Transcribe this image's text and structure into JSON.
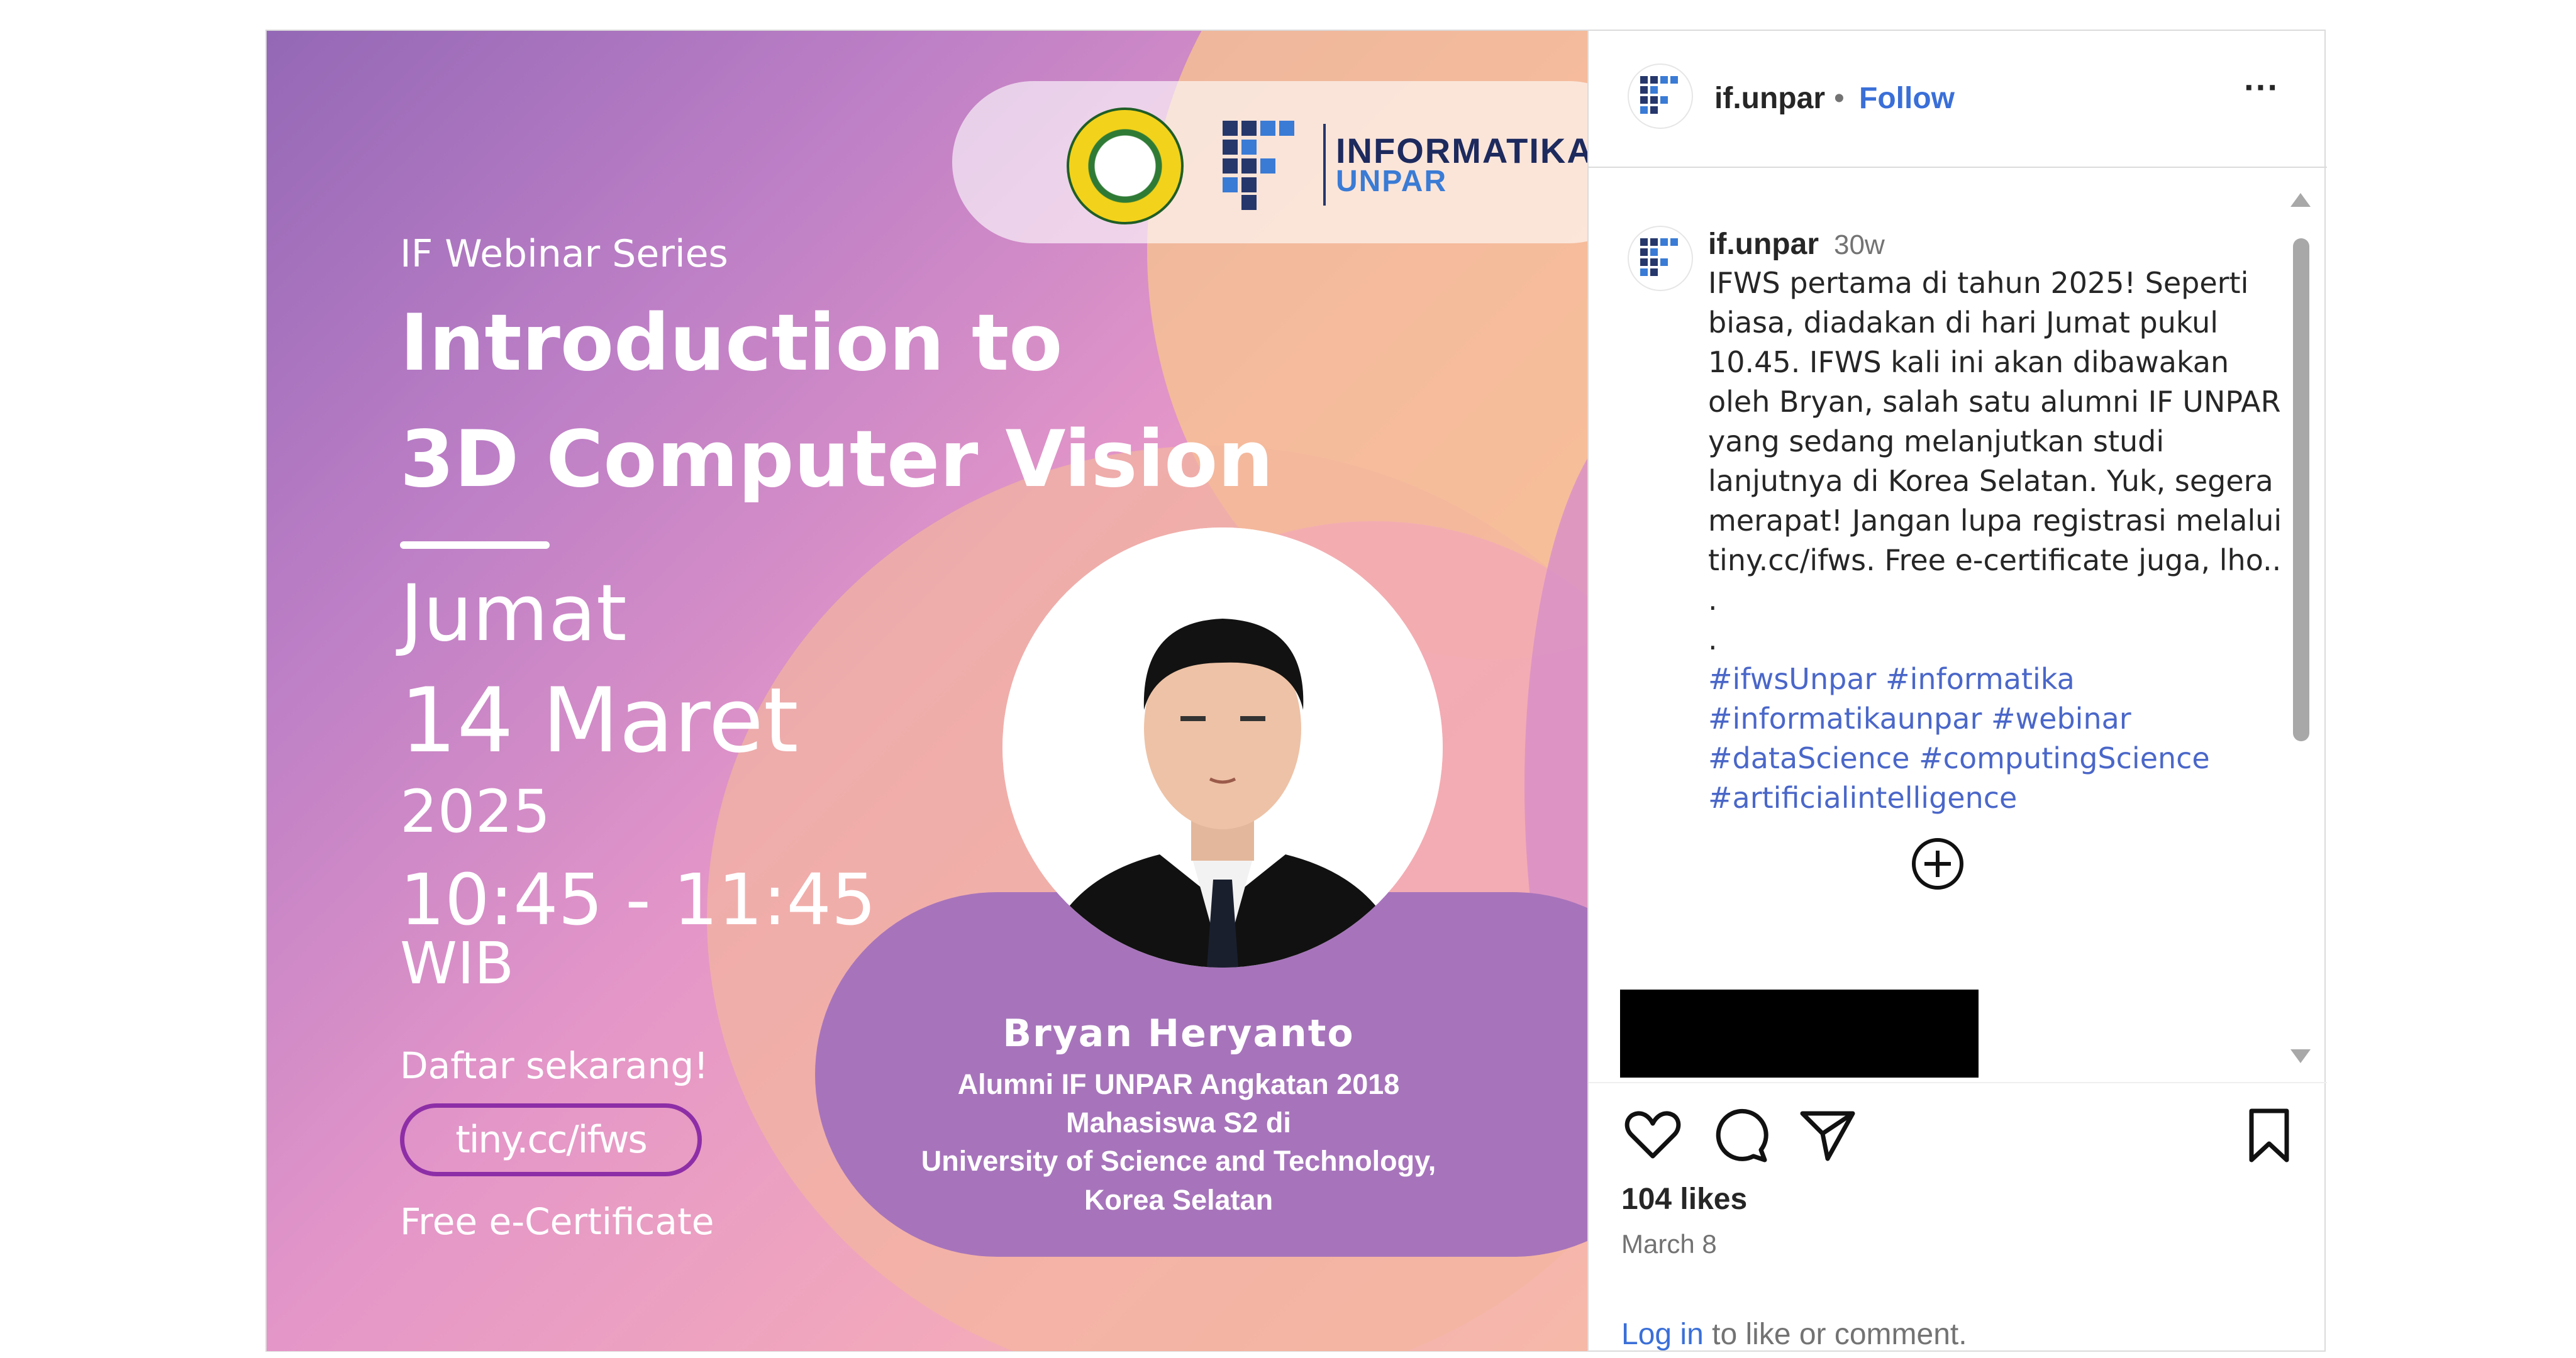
{
  "poster": {
    "series": "IF Webinar Series",
    "title_line1": "Introduction to",
    "title_line2": "3D Computer Vision",
    "day": "Jumat",
    "date": "14 Maret",
    "year": "2025",
    "time": "10:45 - 11:45",
    "timezone": "WIB",
    "register_prompt": "Daftar sekarang!",
    "register_link": "tiny.cc/ifws",
    "certificate": "Free e-Certificate",
    "brand_line1": "INFORMATIKA",
    "brand_line2": "UNPAR",
    "speaker": {
      "name": "Bryan Heryanto",
      "line1": "Alumni IF UNPAR Angkatan 2018",
      "line2": "Mahasiswa S2 di",
      "line3": "University of Science and Technology,",
      "line4": "Korea Selatan"
    }
  },
  "header": {
    "username": "if.unpar",
    "separator": "•",
    "follow_label": "Follow",
    "more_label": "···"
  },
  "comment": {
    "username": "if.unpar",
    "time": "30w",
    "caption_lines": [
      "IFWS pertama di tahun 2025! Seperti",
      "biasa, diadakan di hari Jumat pukul",
      "10.45. IFWS kali ini akan dibawakan",
      "oleh Bryan, salah satu alumni IF UNPAR",
      "yang sedang melanjutkan studi",
      "lanjutnya di Korea Selatan. Yuk, segera",
      "merapat! Jangan lupa registrasi melalui",
      "tiny.cc/ifws. Free e-certificate juga, lho..",
      ".",
      "."
    ],
    "hashtags": [
      [
        "#ifwsUnpar",
        "#informatika"
      ],
      [
        "#informatikaunpar",
        "#webinar"
      ],
      [
        "#dataScience",
        "#computingScience"
      ],
      [
        "#artificialintelligence"
      ]
    ]
  },
  "footer": {
    "likes": "104 likes",
    "date": "March 8",
    "login_link": "Log in",
    "login_rest": " to like or comment."
  },
  "colors": {
    "link": "#3a6fd8",
    "hashtag": "#4a67c9",
    "poster_purple": "#a774bb",
    "register_border": "#8e2ea7"
  },
  "icons": [
    "like-heart-icon",
    "comment-bubble-icon",
    "share-paper-plane-icon",
    "bookmark-icon",
    "add-circle-icon",
    "more-options-icon"
  ]
}
